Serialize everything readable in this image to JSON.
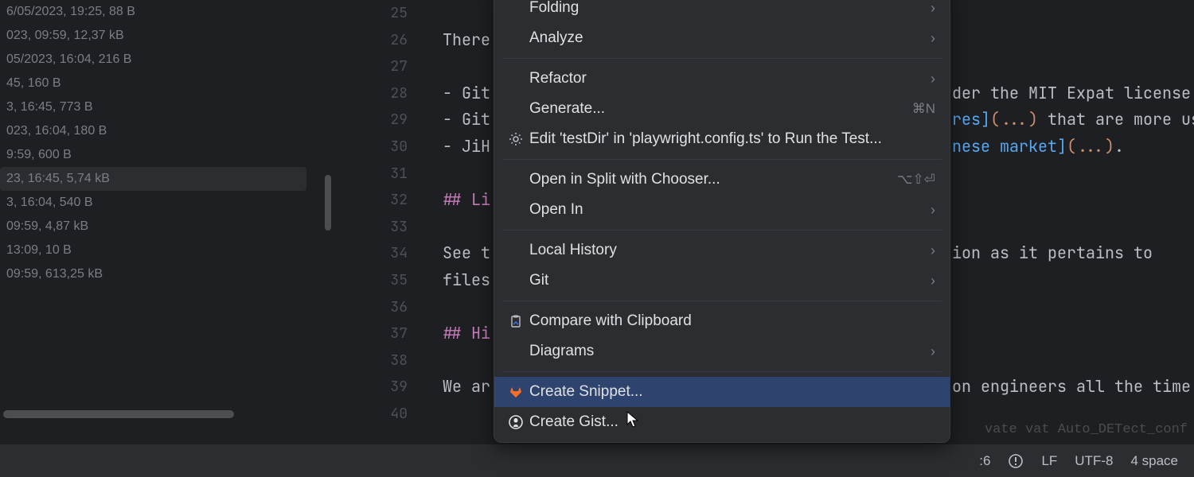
{
  "sidebar": {
    "files": [
      "6/05/2023, 19:25, 88 B",
      "023, 09:59, 12,37 kB",
      "05/2023, 16:04, 216 B",
      "45, 160 B",
      "3, 16:45, 773 B",
      "023, 16:04, 180 B",
      "9:59, 600 B",
      "23, 16:45, 5,74 kB",
      "3, 16:04, 540 B",
      "09:59, 4,87 kB",
      "13:09, 10 B",
      "09:59, 613,25 kB"
    ],
    "selected_index": 7
  },
  "editor": {
    "first_line_number": 25,
    "lines": [
      "",
      "There",
      "",
      "- Git",
      "- Git",
      "- JiH",
      "",
      "## Li",
      "",
      "See t",
      "files",
      "",
      "## Hi",
      "",
      "We ar",
      ""
    ],
    "right_fragments": {
      "4": "der the MIT Expat license",
      "5_text": "res",
      "5_paren": "(...)",
      "5_tail": " that are more us",
      "6_text": "nese market",
      "6_paren": "(...)",
      "6_tail": ".",
      "10": "ion as it pertains to",
      "15": "on engineers all the time"
    }
  },
  "context_menu": {
    "items": [
      {
        "label": "Folding",
        "submenu": true
      },
      {
        "label": "Analyze",
        "submenu": true
      },
      {
        "sep": true
      },
      {
        "label": "Refactor",
        "submenu": true
      },
      {
        "label": "Generate...",
        "shortcut": "⌘N"
      },
      {
        "label": "Edit 'testDir' in 'playwright.config.ts' to Run the Test...",
        "icon": "gear"
      },
      {
        "sep": true
      },
      {
        "label": "Open in Split with Chooser...",
        "shortcut": "⌥⇧⏎"
      },
      {
        "label": "Open In",
        "submenu": true
      },
      {
        "sep": true
      },
      {
        "label": "Local History",
        "submenu": true
      },
      {
        "label": "Git",
        "submenu": true
      },
      {
        "sep": true
      },
      {
        "label": "Compare with Clipboard",
        "icon": "clipboard"
      },
      {
        "label": "Diagrams",
        "submenu": true
      },
      {
        "sep": true
      },
      {
        "label": "Create Snippet...",
        "icon": "gitlab",
        "highlighted": true
      },
      {
        "label": "Create Gist...",
        "icon": "github"
      }
    ]
  },
  "statusbar": {
    "pos": ":6",
    "lf": "LF",
    "encoding": "UTF-8",
    "indent": "4 space",
    "dim_text": "vate vat Auto_DETect_conf"
  }
}
